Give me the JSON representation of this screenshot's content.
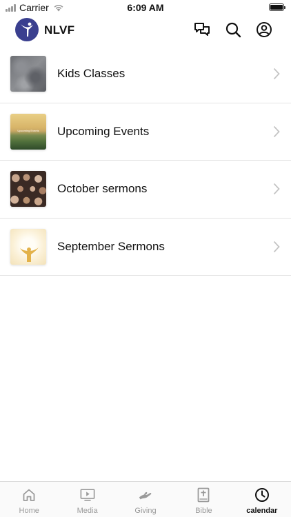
{
  "status_bar": {
    "carrier": "Carrier",
    "time": "6:09 AM"
  },
  "header": {
    "title": "NLVF",
    "logo_color": "#3a3f8f",
    "icons": [
      "chat-icon",
      "search-icon",
      "account-icon"
    ]
  },
  "list": {
    "items": [
      {
        "label": "Kids Classes",
        "thumb": "kids-classes-thumbnail"
      },
      {
        "label": "Upcoming Events",
        "thumb": "upcoming-events-thumbnail",
        "thumb_text": "Upcoming Events"
      },
      {
        "label": "October sermons",
        "thumb": "october-sermons-thumbnail"
      },
      {
        "label": "September Sermons",
        "thumb": "september-sermons-thumbnail"
      }
    ]
  },
  "tab_bar": {
    "active": "calendar",
    "tabs": [
      {
        "label": "Home",
        "icon": "home-icon"
      },
      {
        "label": "Media",
        "icon": "media-icon"
      },
      {
        "label": "Giving",
        "icon": "giving-icon"
      },
      {
        "label": "Bible",
        "icon": "bible-icon"
      },
      {
        "label": "calendar",
        "icon": "clock-icon"
      }
    ]
  }
}
